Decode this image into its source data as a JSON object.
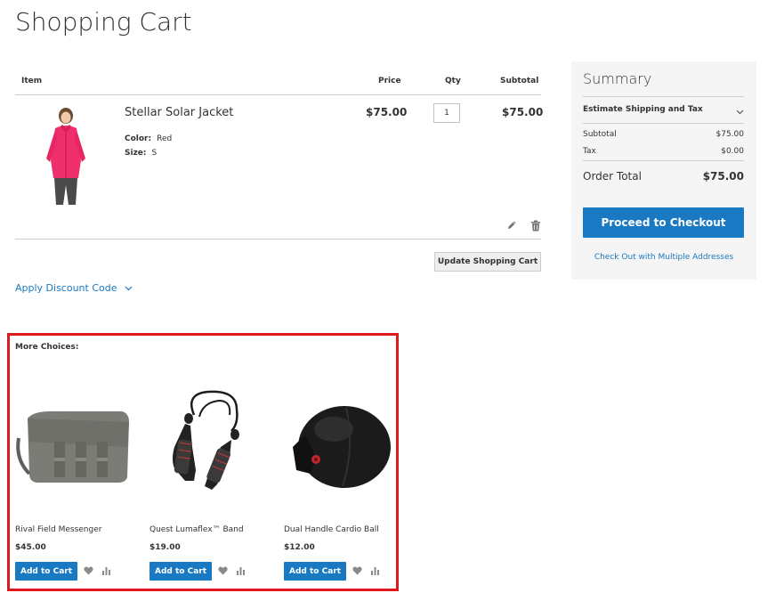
{
  "page_title": "Shopping Cart",
  "cart": {
    "headers": {
      "item": "Item",
      "price": "Price",
      "qty": "Qty",
      "subtotal": "Subtotal"
    },
    "item": {
      "name": "Stellar Solar Jacket",
      "color_label": "Color:",
      "color_value": "Red",
      "size_label": "Size:",
      "size_value": "S",
      "price": "$75.00",
      "qty": "1",
      "subtotal": "$75.00",
      "edit_icon": "pencil-icon",
      "delete_icon": "trash-icon"
    },
    "update_label": "Update Shopping Cart",
    "discount_label": "Apply Discount Code"
  },
  "summary": {
    "title": "Summary",
    "estimate_label": "Estimate Shipping and Tax",
    "subtotal_label": "Subtotal",
    "subtotal_value": "$75.00",
    "tax_label": "Tax",
    "tax_value": "$0.00",
    "total_label": "Order Total",
    "total_value": "$75.00",
    "checkout_label": "Proceed to Checkout",
    "multi_label": "Check Out with Multiple Addresses"
  },
  "more_choices": {
    "title": "More Choices:",
    "products": [
      {
        "name": "Rival Field Messenger",
        "price": "$45.00",
        "add_label": "Add to Cart"
      },
      {
        "name": "Quest Lumaflex™ Band",
        "price": "$19.00",
        "add_label": "Add to Cart"
      },
      {
        "name": "Dual Handle Cardio Ball",
        "price": "$12.00",
        "add_label": "Add to Cart"
      }
    ]
  },
  "colors": {
    "accent": "#1979c3",
    "highlight_border": "#e0191f",
    "summary_bg": "#f5f5f5"
  }
}
